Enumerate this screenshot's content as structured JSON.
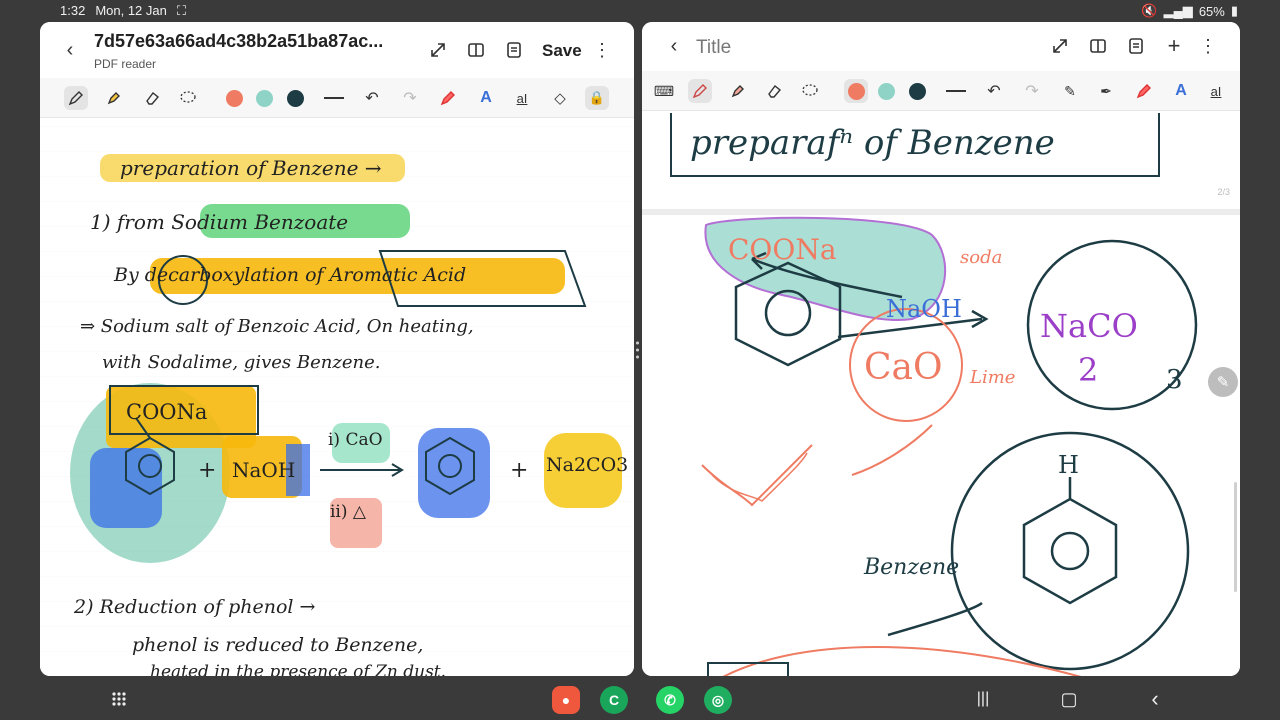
{
  "status": {
    "time": "1:32",
    "date": "Mon, 12 Jan",
    "battery": "65%"
  },
  "left": {
    "title": "7d57e63a66ad4c38b2a51ba87ac...",
    "subtitle": "PDF reader",
    "save_label": "Save",
    "colors": [
      "#ef7b62",
      "#8fd3c7",
      "#1d3c44"
    ],
    "notes": {
      "heading": "preparation of Benzene →",
      "method1": "1) from Sodium Benzoate",
      "by_line": "By decarboxylation of Aromatic Acid",
      "desc1": "⇒ Sodium salt of Benzoic Acid, On heating,",
      "desc2": "with Sodalime, gives Benzene.",
      "coona": "COONa",
      "naoh": "NaOH",
      "cao": "i) CaO",
      "delta": "ii) △",
      "plus1": "+",
      "plus2": "+",
      "na2co3": "Na2CO3",
      "method2": "2) Reduction of phenol →",
      "desc3": "phenol is reduced to Benzene,",
      "desc4": "heated in the presence of Zn dust."
    }
  },
  "right": {
    "title": "Title",
    "colors": [
      "#ef7b62",
      "#8fd3c7",
      "#1d3c44"
    ],
    "page_indicator": "2/3",
    "notes": {
      "box_heading": "preparafⁿ of Benzene",
      "coona": "COONa",
      "soda": "soda",
      "naoh": "NaOH",
      "cao": "CaO",
      "lime": "Lime",
      "na2co3": "NaCO",
      "na2co3_sub2": "2",
      "na2co3_sub3": "3",
      "h_label": "H",
      "benzene_label": "Benzene"
    }
  }
}
